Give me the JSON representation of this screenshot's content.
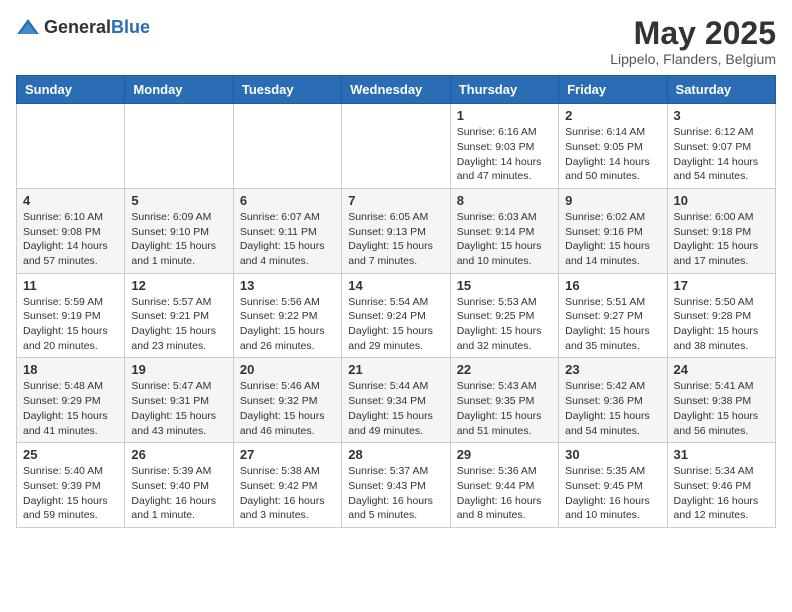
{
  "header": {
    "logo": {
      "general": "General",
      "blue": "Blue"
    },
    "title": "May 2025",
    "location": "Lippelo, Flanders, Belgium"
  },
  "calendar": {
    "headers": [
      "Sunday",
      "Monday",
      "Tuesday",
      "Wednesday",
      "Thursday",
      "Friday",
      "Saturday"
    ],
    "weeks": [
      [
        {
          "day": "",
          "info": ""
        },
        {
          "day": "",
          "info": ""
        },
        {
          "day": "",
          "info": ""
        },
        {
          "day": "",
          "info": ""
        },
        {
          "day": "1",
          "info": "Sunrise: 6:16 AM\nSunset: 9:03 PM\nDaylight: 14 hours\nand 47 minutes."
        },
        {
          "day": "2",
          "info": "Sunrise: 6:14 AM\nSunset: 9:05 PM\nDaylight: 14 hours\nand 50 minutes."
        },
        {
          "day": "3",
          "info": "Sunrise: 6:12 AM\nSunset: 9:07 PM\nDaylight: 14 hours\nand 54 minutes."
        }
      ],
      [
        {
          "day": "4",
          "info": "Sunrise: 6:10 AM\nSunset: 9:08 PM\nDaylight: 14 hours\nand 57 minutes."
        },
        {
          "day": "5",
          "info": "Sunrise: 6:09 AM\nSunset: 9:10 PM\nDaylight: 15 hours\nand 1 minute."
        },
        {
          "day": "6",
          "info": "Sunrise: 6:07 AM\nSunset: 9:11 PM\nDaylight: 15 hours\nand 4 minutes."
        },
        {
          "day": "7",
          "info": "Sunrise: 6:05 AM\nSunset: 9:13 PM\nDaylight: 15 hours\nand 7 minutes."
        },
        {
          "day": "8",
          "info": "Sunrise: 6:03 AM\nSunset: 9:14 PM\nDaylight: 15 hours\nand 10 minutes."
        },
        {
          "day": "9",
          "info": "Sunrise: 6:02 AM\nSunset: 9:16 PM\nDaylight: 15 hours\nand 14 minutes."
        },
        {
          "day": "10",
          "info": "Sunrise: 6:00 AM\nSunset: 9:18 PM\nDaylight: 15 hours\nand 17 minutes."
        }
      ],
      [
        {
          "day": "11",
          "info": "Sunrise: 5:59 AM\nSunset: 9:19 PM\nDaylight: 15 hours\nand 20 minutes."
        },
        {
          "day": "12",
          "info": "Sunrise: 5:57 AM\nSunset: 9:21 PM\nDaylight: 15 hours\nand 23 minutes."
        },
        {
          "day": "13",
          "info": "Sunrise: 5:56 AM\nSunset: 9:22 PM\nDaylight: 15 hours\nand 26 minutes."
        },
        {
          "day": "14",
          "info": "Sunrise: 5:54 AM\nSunset: 9:24 PM\nDaylight: 15 hours\nand 29 minutes."
        },
        {
          "day": "15",
          "info": "Sunrise: 5:53 AM\nSunset: 9:25 PM\nDaylight: 15 hours\nand 32 minutes."
        },
        {
          "day": "16",
          "info": "Sunrise: 5:51 AM\nSunset: 9:27 PM\nDaylight: 15 hours\nand 35 minutes."
        },
        {
          "day": "17",
          "info": "Sunrise: 5:50 AM\nSunset: 9:28 PM\nDaylight: 15 hours\nand 38 minutes."
        }
      ],
      [
        {
          "day": "18",
          "info": "Sunrise: 5:48 AM\nSunset: 9:29 PM\nDaylight: 15 hours\nand 41 minutes."
        },
        {
          "day": "19",
          "info": "Sunrise: 5:47 AM\nSunset: 9:31 PM\nDaylight: 15 hours\nand 43 minutes."
        },
        {
          "day": "20",
          "info": "Sunrise: 5:46 AM\nSunset: 9:32 PM\nDaylight: 15 hours\nand 46 minutes."
        },
        {
          "day": "21",
          "info": "Sunrise: 5:44 AM\nSunset: 9:34 PM\nDaylight: 15 hours\nand 49 minutes."
        },
        {
          "day": "22",
          "info": "Sunrise: 5:43 AM\nSunset: 9:35 PM\nDaylight: 15 hours\nand 51 minutes."
        },
        {
          "day": "23",
          "info": "Sunrise: 5:42 AM\nSunset: 9:36 PM\nDaylight: 15 hours\nand 54 minutes."
        },
        {
          "day": "24",
          "info": "Sunrise: 5:41 AM\nSunset: 9:38 PM\nDaylight: 15 hours\nand 56 minutes."
        }
      ],
      [
        {
          "day": "25",
          "info": "Sunrise: 5:40 AM\nSunset: 9:39 PM\nDaylight: 15 hours\nand 59 minutes."
        },
        {
          "day": "26",
          "info": "Sunrise: 5:39 AM\nSunset: 9:40 PM\nDaylight: 16 hours\nand 1 minute."
        },
        {
          "day": "27",
          "info": "Sunrise: 5:38 AM\nSunset: 9:42 PM\nDaylight: 16 hours\nand 3 minutes."
        },
        {
          "day": "28",
          "info": "Sunrise: 5:37 AM\nSunset: 9:43 PM\nDaylight: 16 hours\nand 5 minutes."
        },
        {
          "day": "29",
          "info": "Sunrise: 5:36 AM\nSunset: 9:44 PM\nDaylight: 16 hours\nand 8 minutes."
        },
        {
          "day": "30",
          "info": "Sunrise: 5:35 AM\nSunset: 9:45 PM\nDaylight: 16 hours\nand 10 minutes."
        },
        {
          "day": "31",
          "info": "Sunrise: 5:34 AM\nSunset: 9:46 PM\nDaylight: 16 hours\nand 12 minutes."
        }
      ]
    ]
  }
}
